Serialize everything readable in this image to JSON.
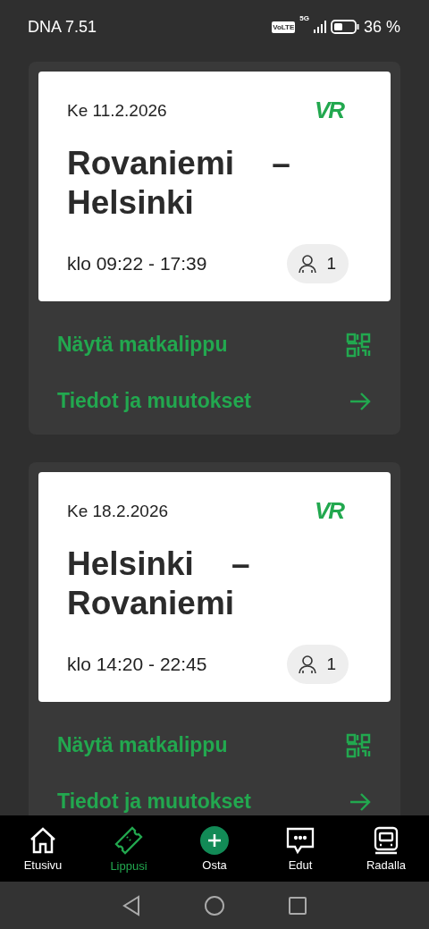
{
  "status_bar": {
    "carrier_time": "DNA 7.51",
    "volte": "VoLTE",
    "network": "5G",
    "battery": "36 %"
  },
  "tickets": [
    {
      "date": "Ke 11.2.2026",
      "logo": "VR",
      "origin": "Rovaniemi",
      "separator": "–",
      "destination": "Helsinki",
      "time": "klo 09:22 - 17:39",
      "passengers": "1",
      "actions": [
        {
          "kind": "qr",
          "label": "Näytä matkalippu"
        },
        {
          "kind": "arrow",
          "label": "Tiedot ja muutokset"
        }
      ]
    },
    {
      "date": "Ke 18.2.2026",
      "logo": "VR",
      "origin": "Helsinki",
      "separator": "–",
      "destination": "Rovaniemi",
      "time": "klo 14:20 - 22:45",
      "passengers": "1",
      "actions": [
        {
          "kind": "qr",
          "label": "Näytä matkalippu"
        },
        {
          "kind": "arrow",
          "label": "Tiedot ja muutokset"
        }
      ]
    }
  ],
  "bottom_nav": [
    {
      "kind": "home",
      "label": "Etusivu",
      "selected": false
    },
    {
      "kind": "ticket",
      "label": "Lippusi",
      "selected": true
    },
    {
      "kind": "buy",
      "label": "Osta",
      "selected": false
    },
    {
      "kind": "chat",
      "label": "Edut",
      "selected": false
    },
    {
      "kind": "train",
      "label": "Radalla",
      "selected": false
    }
  ]
}
